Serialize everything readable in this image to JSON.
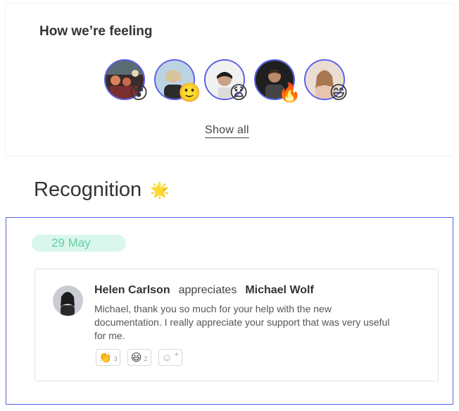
{
  "feeling": {
    "title": "How we’re feeling",
    "avatars": [
      {
        "emoji": "😵",
        "emoji_name": "dizzy-face-icon"
      },
      {
        "emoji": "🙂",
        "emoji_name": "slight-smile-icon"
      },
      {
        "emoji": "😧",
        "emoji_name": "anguished-face-icon"
      },
      {
        "emoji": "🔥",
        "emoji_name": "fire-icon"
      },
      {
        "emoji": "😄",
        "emoji_name": "grin-icon"
      }
    ],
    "show_all_label": "Show all"
  },
  "recognition": {
    "title": "Recognition",
    "icon": "🌟",
    "date": "29 May",
    "post": {
      "author": "Helen Carlson",
      "verb": "appreciates",
      "recipient": "Michael Wolf",
      "message": "Michael, thank you so much for your help with the new documentation. I really appreciate your support that was very useful for me.",
      "reactions": [
        {
          "emoji": "👏",
          "count": "3",
          "name": "clap-icon"
        },
        {
          "emoji": "😃",
          "count": "2",
          "name": "smiley-icon"
        }
      ],
      "add_reaction_icon": "add-reaction-icon"
    }
  },
  "colors": {
    "accent": "#5b5fe6",
    "date_bg": "#d9f7ec",
    "date_text": "#5fd0a3"
  }
}
